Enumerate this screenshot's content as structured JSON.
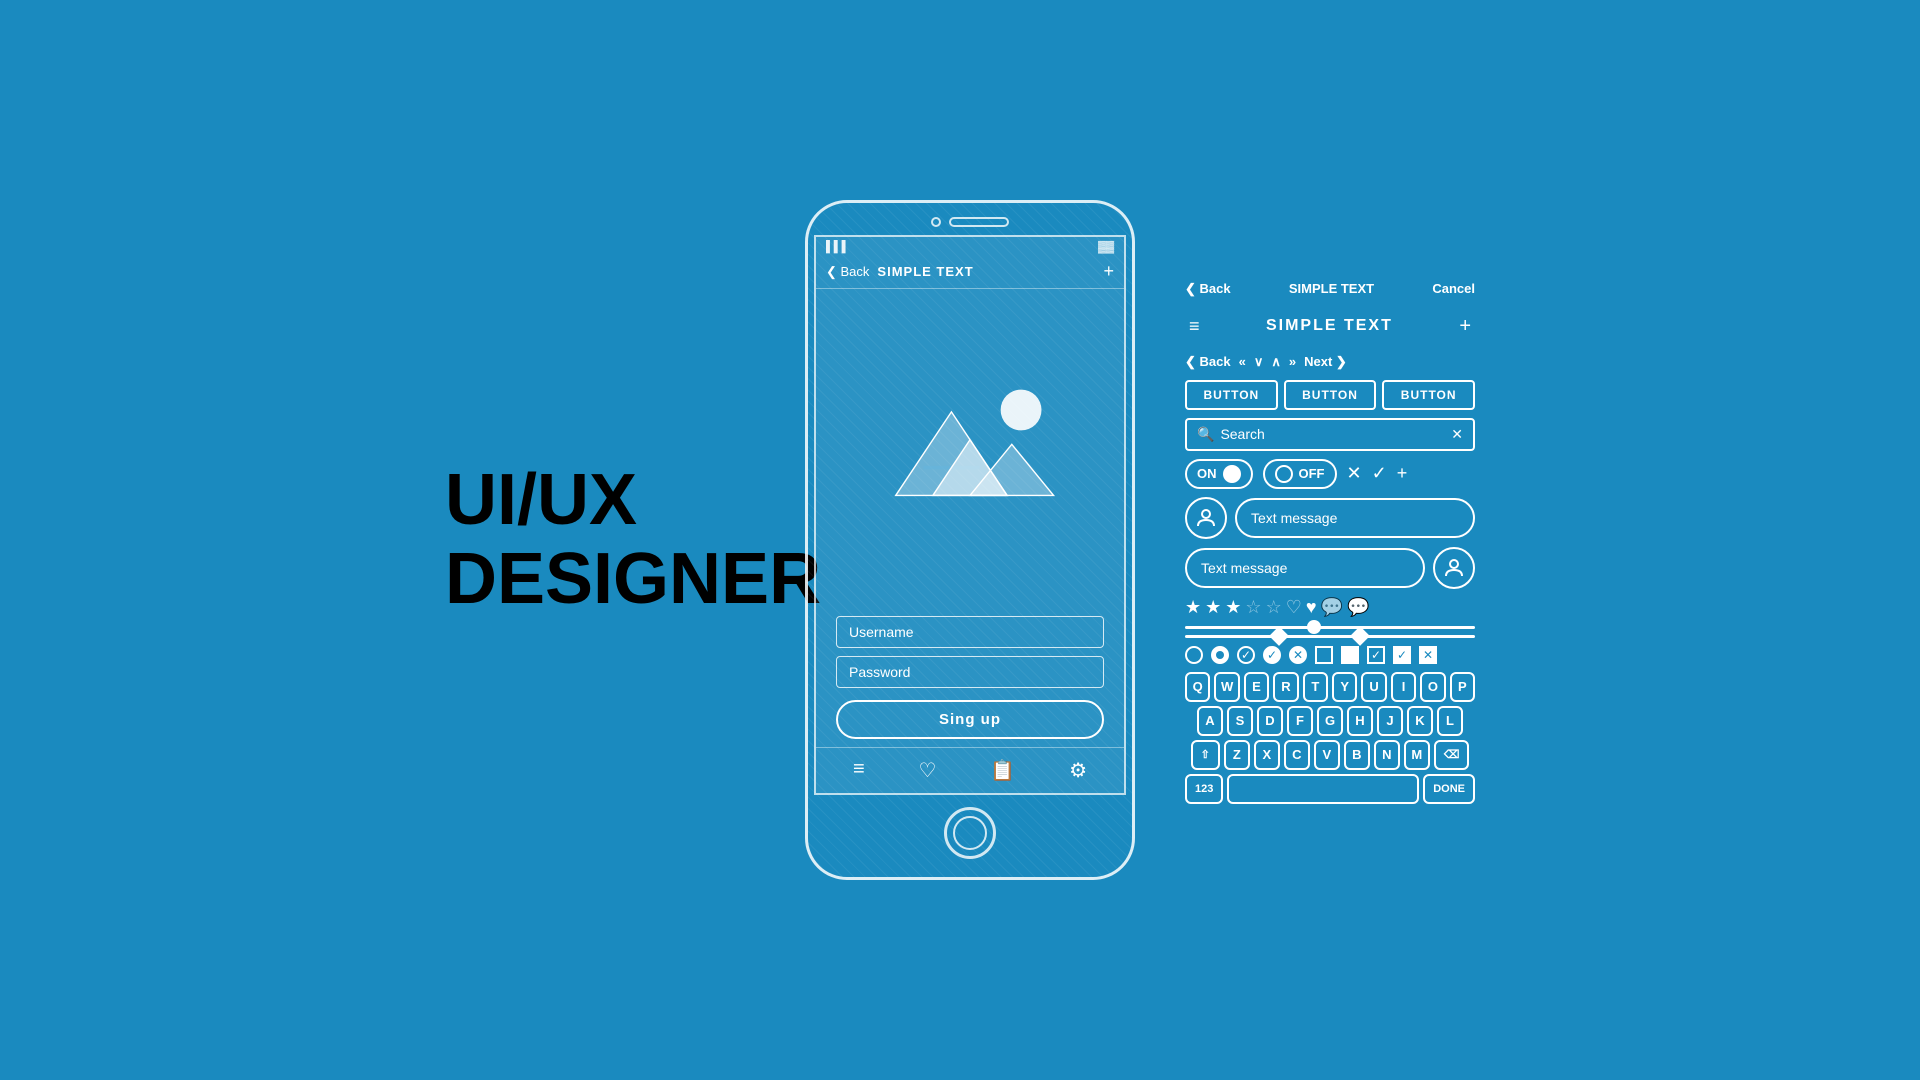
{
  "title": {
    "line1": "UI/UX",
    "line2": "DESIGNER"
  },
  "phone": {
    "status_signal": "▌▌▌",
    "status_battery": "▓▓▓",
    "nav_back": "❮ Back",
    "nav_title": "SIMPLE TEXT",
    "nav_plus": "+",
    "username_placeholder": "Username",
    "password_placeholder": "Password",
    "signup_button": "Sing up",
    "tabs": [
      "≡",
      "♡",
      "📋",
      "⚙"
    ]
  },
  "ui_panel": {
    "nav_top": {
      "back": "❮ Back",
      "title": "SIMPLE TEXT",
      "cancel": "Cancel"
    },
    "title_bar": {
      "hamburger": "≡",
      "title": "SIMPLE TEXT",
      "plus": "+"
    },
    "nav2": {
      "back": "❮ Back",
      "prev_prev": "«",
      "down": "∨",
      "up": "∧",
      "next_next": "»",
      "next": "Next ❯"
    },
    "buttons": [
      "BUTTON",
      "BUTTON",
      "BUTTON"
    ],
    "search": {
      "placeholder": "Search",
      "clear": "✕"
    },
    "toggle_on": "ON",
    "toggle_off": "OFF",
    "chat": {
      "message1": "Text message",
      "message2": "Text message"
    },
    "keyboard": {
      "row1": [
        "Q",
        "W",
        "E",
        "R",
        "T",
        "Y",
        "U",
        "I",
        "O",
        "P"
      ],
      "row2": [
        "A",
        "S",
        "D",
        "F",
        "G",
        "H",
        "J",
        "K",
        "L"
      ],
      "row3": [
        "⇧",
        "Z",
        "X",
        "C",
        "V",
        "B",
        "N",
        "M",
        "⌫"
      ],
      "bottom_left": "123",
      "done": "DONE"
    }
  }
}
